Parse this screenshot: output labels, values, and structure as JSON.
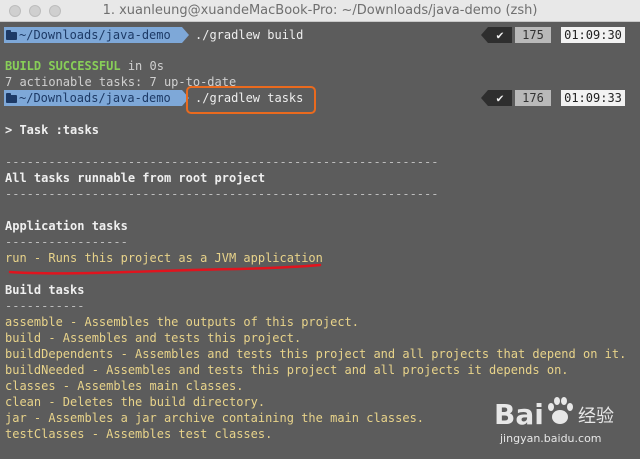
{
  "window": {
    "title": "1. xuanleung@xuandeMacBook-Pro: ~/Downloads/java-demo (zsh)"
  },
  "prompt1": {
    "path": "~/Downloads/java-demo",
    "command": "./gradlew build",
    "status_icon": "check-icon",
    "status_check": "✔",
    "history": "175",
    "time": "01:09:30"
  },
  "build": {
    "success_label": "BUILD SUCCESSFUL",
    "success_rest": " in 0s",
    "actionable": "7 actionable tasks: 7 up-to-date"
  },
  "prompt2": {
    "path": "~/Downloads/java-demo",
    "command": "./gradlew tasks",
    "status_check": "✔",
    "history": "176",
    "time": "01:09:33"
  },
  "output": {
    "task_header": "> Task :tasks",
    "rule_long": "------------------------------------------------------------",
    "all_tasks": "All tasks runnable from root project",
    "app_tasks_heading": "Application tasks",
    "rule_app": "-----------------",
    "run_task": "run - Runs this project as a JVM application",
    "build_tasks_heading": "Build tasks",
    "rule_build": "-----------",
    "build_tasks": [
      "assemble - Assembles the outputs of this project.",
      "build - Assembles and tests this project.",
      "buildDependents - Assembles and tests this project and all projects that depend on it.",
      "buildNeeded - Assembles and tests this project and all projects it depends on.",
      "classes - Assembles main classes.",
      "clean - Deletes the build directory.",
      "jar - Assembles a jar archive containing the main classes.",
      "testClasses - Assembles test classes."
    ]
  },
  "annotations": {
    "highlight_color": "#ea6a1e",
    "underline_color": "#e0141e"
  },
  "watermark": {
    "brand_left": "Bai",
    "brand_cn": "经验",
    "url": "jingyan.baidu.com"
  },
  "colors": {
    "background": "#5c5c5c",
    "prompt_path_bg": "#7ea8d8",
    "task_text": "#e8d38a",
    "success": "#88cf58"
  }
}
